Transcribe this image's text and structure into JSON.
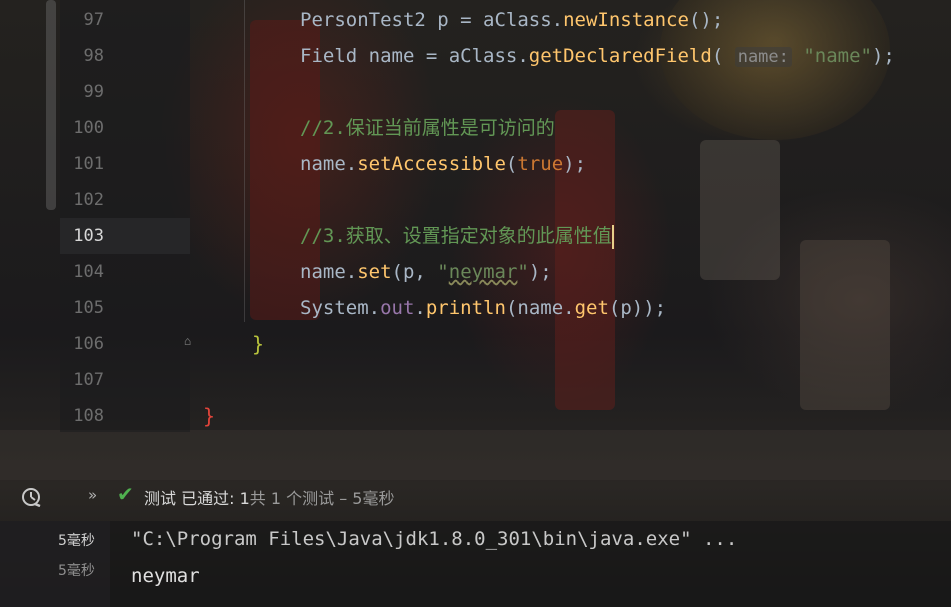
{
  "editor": {
    "lines": [
      {
        "num": "97"
      },
      {
        "num": "98"
      },
      {
        "num": "99"
      },
      {
        "num": "100"
      },
      {
        "num": "101"
      },
      {
        "num": "102"
      },
      {
        "num": "103"
      },
      {
        "num": "104"
      },
      {
        "num": "105"
      },
      {
        "num": "106"
      },
      {
        "num": "107"
      },
      {
        "num": "108"
      }
    ],
    "current_line": "103",
    "code": {
      "l97": {
        "a": "PersonTest2 p = aClass.",
        "b": "newInstance",
        "c": "();"
      },
      "l98": {
        "a": "Field name = aClass.",
        "b": "getDeclaredField",
        "c": "( ",
        "hint": "name:",
        "d": " ",
        "str": "\"name\"",
        "e": ");"
      },
      "l100": {
        "comment": "//2.保证当前属性是可访问的"
      },
      "l101": {
        "a": "name.",
        "b": "setAccessible",
        "c": "(",
        "kw": "true",
        "d": ");"
      },
      "l103": {
        "comment": "//3.获取、设置指定对象的此属性值"
      },
      "l104": {
        "a": "name.",
        "b": "set",
        "c": "(p, ",
        "str_q1": "\"",
        "str_mid": "neymar",
        "str_q2": "\"",
        "d": ");"
      },
      "l105": {
        "a": "System.",
        "field": "out",
        "b": ".",
        "fn": "println",
        "c": "(name.",
        "fn2": "get",
        "d": "(p));"
      },
      "l106": {
        "brace": "}"
      },
      "l108": {
        "brace": "}"
      }
    }
  },
  "testbar": {
    "icon": "stopwatch-icon",
    "chevron": "»",
    "check": "✔",
    "label": "测试",
    "passed": "已通过: 1",
    "summary": "共 1 个测试 – 5毫秒"
  },
  "console": {
    "times": [
      "5毫秒",
      "5毫秒"
    ],
    "lines": [
      "\"C:\\Program Files\\Java\\jdk1.8.0_301\\bin\\java.exe\" ...",
      "neymar"
    ]
  },
  "colors": {
    "keyword": "#cc7832",
    "method": "#ffc66d",
    "string": "#6a8759",
    "comment": "#629755",
    "field": "#9876aa",
    "brace_106": "#b7c23c",
    "brace_108": "#e0443a",
    "pass": "#4fb04f"
  }
}
